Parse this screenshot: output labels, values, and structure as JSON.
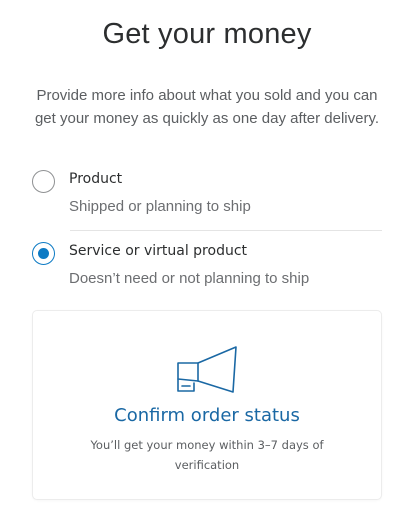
{
  "header": {
    "title": "Get your money",
    "subtitle": "Provide more info about what you sold and you can get your money as quickly as one day after delivery."
  },
  "options": [
    {
      "label": "Product",
      "description": "Shipped or planning to ship",
      "selected": false
    },
    {
      "label": "Service or virtual product",
      "description": "Doesn’t need or not planning to ship",
      "selected": true
    }
  ],
  "info_card": {
    "icon": "megaphone-icon",
    "title": "Confirm order status",
    "description": "You’ll get your money within 3–7 days of verification"
  },
  "colors": {
    "accent": "#0c7ac4",
    "card_title": "#1a68a4",
    "text_primary": "#2c2e2f",
    "text_secondary": "#6c6e71"
  }
}
